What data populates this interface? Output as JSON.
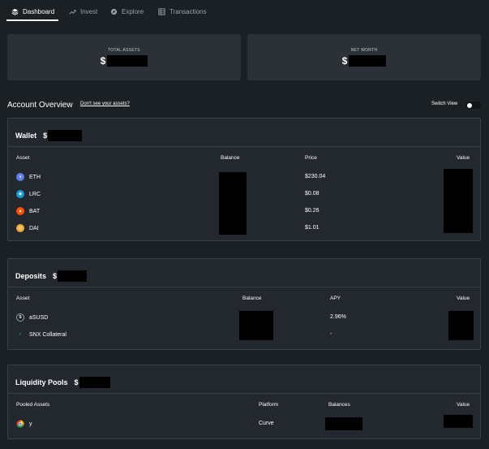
{
  "nav": {
    "tabs": [
      {
        "label": "Dashboard",
        "icon": "stack-icon"
      },
      {
        "label": "Invest",
        "icon": "trend-line-icon"
      },
      {
        "label": "Explore",
        "icon": "compass-icon"
      },
      {
        "label": "Transactions",
        "icon": "grid-icon"
      }
    ]
  },
  "summary": {
    "total_assets": {
      "label": "TOTAL ASSETS",
      "currency": "$"
    },
    "net_worth": {
      "label": "NET WORTH",
      "currency": "$"
    }
  },
  "overview": {
    "title": "Account Overview",
    "link": "Don't see your assets?",
    "switch_label": "Switch View"
  },
  "wallet": {
    "title": "Wallet",
    "currency": "$",
    "columns": {
      "asset": "Asset",
      "balance": "Balance",
      "price": "Price",
      "value": "Value"
    },
    "rows": [
      {
        "asset": "ETH",
        "price": "$230.04",
        "icon": "eth-icon",
        "color": "#627eea"
      },
      {
        "asset": "LRC",
        "price": "$0.08",
        "icon": "lrc-icon",
        "color": "#1c9bd9"
      },
      {
        "asset": "BAT",
        "price": "$0.26",
        "icon": "bat-icon",
        "color": "#ff5000"
      },
      {
        "asset": "DAI",
        "price": "$1.01",
        "icon": "dai-icon",
        "color": "#f5ac37"
      }
    ]
  },
  "deposits": {
    "title": "Deposits",
    "currency": "$",
    "columns": {
      "asset": "Asset",
      "balance": "Balance",
      "apy": "APY",
      "value": "Value"
    },
    "rows": [
      {
        "asset": "aSUSD",
        "apy": "2.96%",
        "icon": "asusd-icon"
      },
      {
        "asset": "SNX Collateral",
        "apy": "-",
        "icon": "snx-icon"
      }
    ]
  },
  "pools": {
    "title": "Liquidity Pools",
    "currency": "$",
    "columns": {
      "assets": "Pooled Assets",
      "platform": "Platform",
      "balances": "Balances",
      "value": "Value"
    },
    "rows": [
      {
        "asset": "y",
        "platform": "Curve",
        "icon": "curve-y-icon"
      }
    ]
  }
}
